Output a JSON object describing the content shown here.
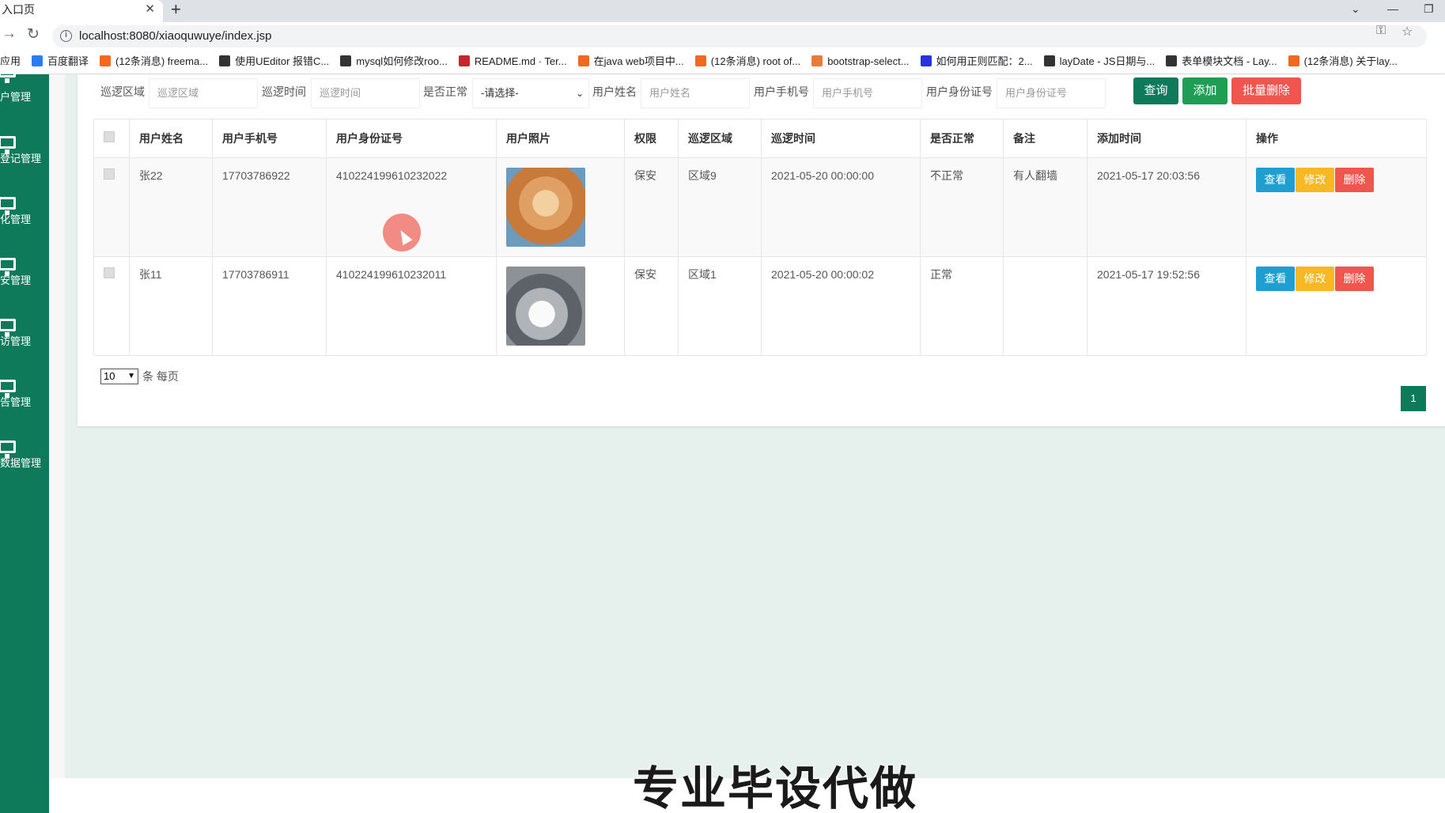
{
  "browser": {
    "tab_title": "入口页",
    "url": "localhost:8080/xiaoquwuye/index.jsp",
    "bookmarks": [
      {
        "label": "应用",
        "color": "#fff"
      },
      {
        "label": "百度翻译",
        "color": "#2b7cf0"
      },
      {
        "label": "(12条消息) freema...",
        "color": "#f3681f"
      },
      {
        "label": "使用UEditor 报错C...",
        "color": "#333"
      },
      {
        "label": "mysql如何修改roo...",
        "color": "#333"
      },
      {
        "label": "README.md · Ter...",
        "color": "#c7262d"
      },
      {
        "label": "在java web项目中...",
        "color": "#f3681f"
      },
      {
        "label": "(12条消息) root of...",
        "color": "#f3681f"
      },
      {
        "label": "bootstrap-select...",
        "color": "#e87a3a"
      },
      {
        "label": "如何用正则匹配：2...",
        "color": "#2932e1"
      },
      {
        "label": "layDate - JS日期与...",
        "color": "#333"
      },
      {
        "label": "表单模块文档 - Lay...",
        "color": "#333"
      },
      {
        "label": "(12条消息) 关于lay...",
        "color": "#f3681f"
      }
    ]
  },
  "sidebar": {
    "items": [
      {
        "label": "户管理"
      },
      {
        "label": "登记管理"
      },
      {
        "label": "化管理"
      },
      {
        "label": "安管理"
      },
      {
        "label": "访管理"
      },
      {
        "label": "告管理"
      },
      {
        "label": "数据管理"
      }
    ]
  },
  "filters": {
    "area": {
      "label": "巡逻区域",
      "placeholder": "巡逻区域"
    },
    "time": {
      "label": "巡逻时间",
      "placeholder": "巡逻时间"
    },
    "normal": {
      "label": "是否正常",
      "value": "-请选择-"
    },
    "name": {
      "label": "用户姓名",
      "placeholder": "用户姓名"
    },
    "phone": {
      "label": "用户手机号",
      "placeholder": "用户手机号"
    },
    "idcard": {
      "label": "用户身份证号",
      "placeholder": "用户身份证号"
    }
  },
  "buttons": {
    "query": "查询",
    "add": "添加",
    "bulk_delete": "批量删除"
  },
  "table": {
    "headers": [
      "用户姓名",
      "用户手机号",
      "用户身份证号",
      "用户照片",
      "权限",
      "巡逻区域",
      "巡逻时间",
      "是否正常",
      "备注",
      "添加时间",
      "操作"
    ],
    "rows": [
      {
        "name": "张22",
        "phone": "17703786922",
        "idcard": "410224199610232022",
        "role": "保安",
        "area": "区域9",
        "time": "2021-05-20 00:00:00",
        "normal": "不正常",
        "remark": "有人翻墙",
        "added": "2021-05-17 20:03:56"
      },
      {
        "name": "张11",
        "phone": "17703786911",
        "idcard": "410224199610232011",
        "role": "保安",
        "area": "区域1",
        "time": "2021-05-20 00:00:02",
        "normal": "正常",
        "remark": "",
        "added": "2021-05-17 19:52:56"
      }
    ],
    "actions": {
      "view": "查看",
      "edit": "修改",
      "delete": "删除"
    }
  },
  "pager": {
    "size": "10",
    "size_label": "条 每页",
    "current_page": "1"
  },
  "watermark": "专业毕设代做"
}
